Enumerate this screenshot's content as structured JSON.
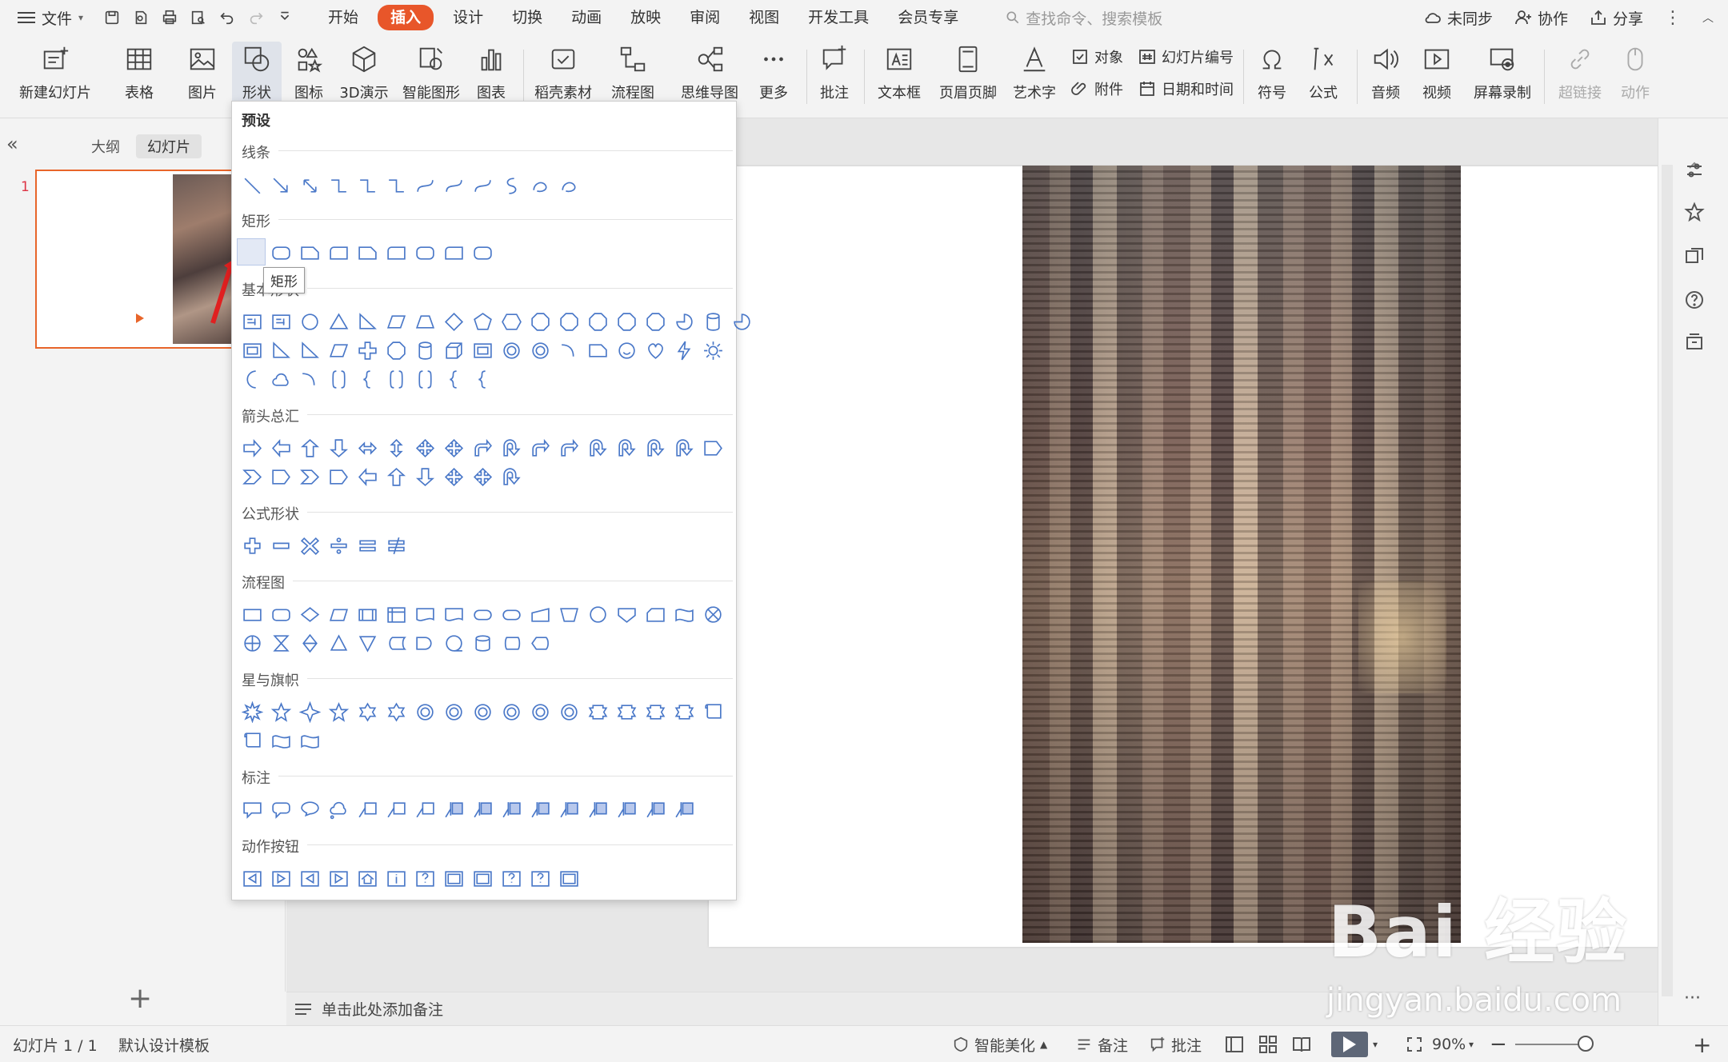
{
  "menubar": {
    "file_label": "文件",
    "tabs": [
      "开始",
      "插入",
      "设计",
      "切换",
      "动画",
      "放映",
      "审阅",
      "视图",
      "开发工具",
      "会员专享"
    ],
    "active_tab": "插入",
    "search_placeholder": "查找命令、搜索模板",
    "sync_label": "未同步",
    "collab_label": "协作",
    "share_label": "分享"
  },
  "ribbon": {
    "new_slide": "新建幻灯片",
    "table": "表格",
    "picture": "图片",
    "shape": "形状",
    "icon": "图标",
    "three_d": "3D演示",
    "smart_art": "智能图形",
    "chart": "图表",
    "docer": "稻壳素材",
    "flowchart": "流程图",
    "mindmap": "思维导图",
    "more": "更多",
    "comment": "批注",
    "textbox": "文本框",
    "header_footer": "页眉页脚",
    "wordart": "艺术字",
    "object": "对象",
    "slide_number": "幻灯片编号",
    "attachment": "附件",
    "datetime": "日期和时间",
    "symbol": "符号",
    "formula": "公式",
    "audio": "音频",
    "video": "视频",
    "screen_record": "屏幕录制",
    "hyperlink": "超链接",
    "action": "动作"
  },
  "left_panel": {
    "outline_tab": "大纲",
    "slides_tab": "幻灯片",
    "slide_number": "1"
  },
  "shape_menu": {
    "header": "预设",
    "sections": {
      "lines": "线条",
      "rect": "矩形",
      "basic": "基本形状",
      "arrows": "箭头总汇",
      "equation": "公式形状",
      "flowchart": "流程图",
      "stars": "星与旗帜",
      "callouts": "标注",
      "action_buttons": "动作按钮"
    },
    "tooltip": "矩形"
  },
  "notes": {
    "placeholder": "单击此处添加备注"
  },
  "status": {
    "slide_info": "幻灯片 1 / 1",
    "template": "默认设计模板",
    "beautify": "智能美化",
    "notes": "备注",
    "comments": "批注",
    "zoom": "90%"
  },
  "watermark": {
    "brand": "Bai 经验",
    "url": "jingyan.baidu.com"
  },
  "colors": {
    "accent": "#e8562a",
    "shape_stroke": "#4a78c8"
  }
}
